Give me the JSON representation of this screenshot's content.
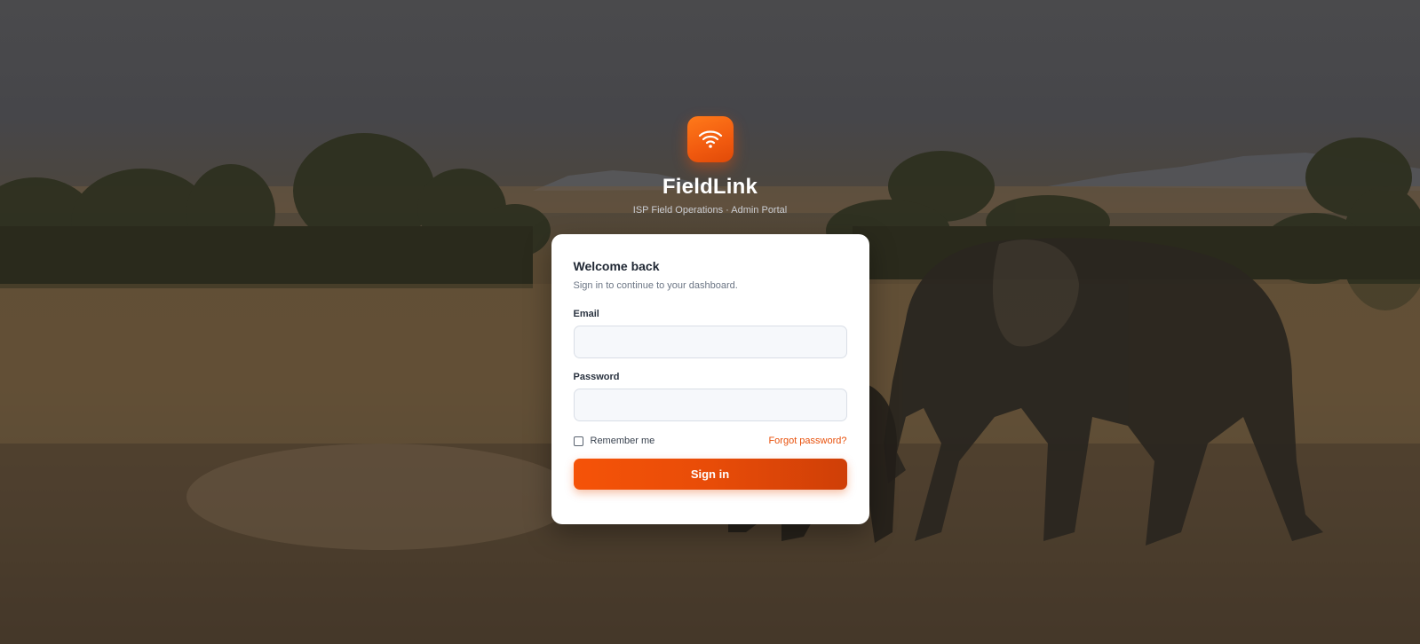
{
  "brand": {
    "logo_icon": "wifi-icon",
    "name": "FieldLink",
    "tagline": "ISP Field Operations · Admin Portal"
  },
  "card": {
    "title": "Welcome back",
    "subtitle": "Sign in to continue to your dashboard.",
    "email_label": "Email",
    "email_value": "",
    "password_label": "Password",
    "password_value": "",
    "remember_label": "Remember me",
    "remember_checked": false,
    "forgot_label": "Forgot password?",
    "signin_label": "Sign in"
  },
  "colors": {
    "accent": "#f15a0f",
    "accent_dark": "#cf3f07",
    "card_bg": "#ffffff"
  }
}
